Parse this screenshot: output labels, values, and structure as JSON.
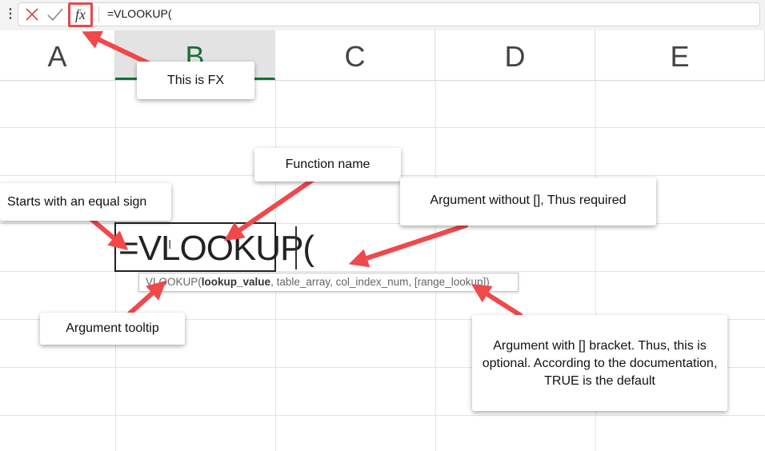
{
  "formula_bar": {
    "menu_icon": "vertical-dots-icon",
    "cancel_icon": "close-icon",
    "enter_icon": "checkmark-icon",
    "fx_label": "fx",
    "value": "=VLOOKUP("
  },
  "columns": [
    "A",
    "B",
    "C",
    "D",
    "E"
  ],
  "selected_column": "B",
  "cell": {
    "value": "=VLOOKUP("
  },
  "tooltip": {
    "function": "VLOOKUP(",
    "arg1": "lookup_value",
    "rest": ", table_array, col_index_num, [range_lookup])"
  },
  "callouts": {
    "fx": "This is FX",
    "function_name": "Function name",
    "equal_sign": "Starts with an equal sign",
    "required": "Argument without [], Thus required",
    "tooltip": "Argument tooltip",
    "optional": "Argument with [] bracket. Thus, this is optional. According to the documentation, TRUE is the default"
  },
  "colors": {
    "arrow": "#f0484b",
    "highlight_border": "#e8474b",
    "selected_header_underline": "#137333"
  }
}
